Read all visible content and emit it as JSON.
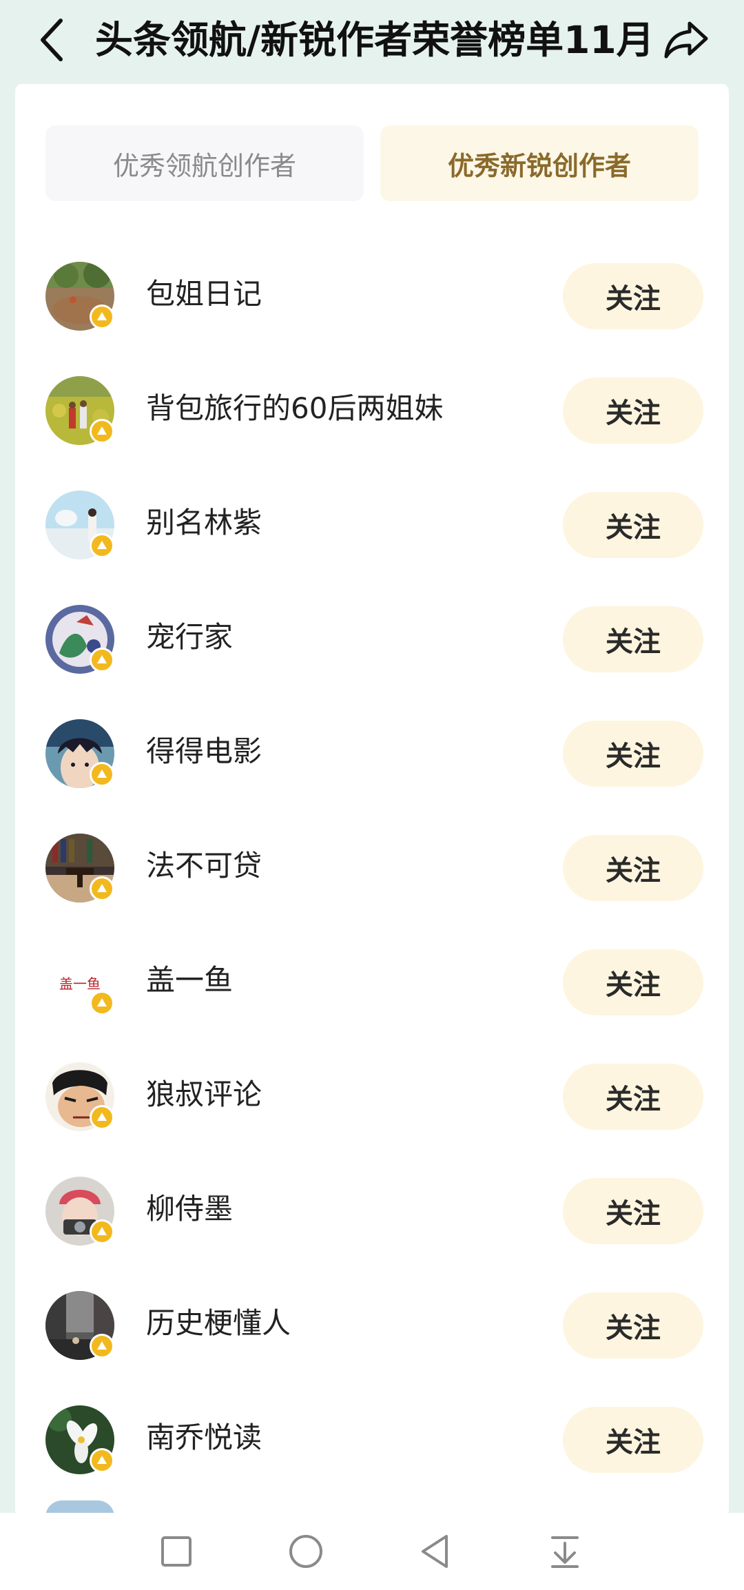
{
  "header": {
    "title": "头条领航/新锐作者荣誉榜单11月",
    "back_icon": "chevron-left-icon",
    "share_icon": "share-icon"
  },
  "tabs": [
    {
      "label": "优秀领航创作者",
      "selected": false
    },
    {
      "label": "优秀新锐创作者",
      "selected": true
    }
  ],
  "authors": [
    {
      "name": "包姐日记",
      "follow_label": "关注"
    },
    {
      "name": "背包旅行的60后两姐妹",
      "follow_label": "关注"
    },
    {
      "name": "别名林紫",
      "follow_label": "关注"
    },
    {
      "name": "宠行家",
      "follow_label": "关注"
    },
    {
      "name": "得得电影",
      "follow_label": "关注"
    },
    {
      "name": "法不可贷",
      "follow_label": "关注"
    },
    {
      "name": "盖一鱼",
      "follow_label": "关注",
      "avatar_text": "盖一鱼"
    },
    {
      "name": "狼叔评论",
      "follow_label": "关注"
    },
    {
      "name": "柳侍墨",
      "follow_label": "关注"
    },
    {
      "name": "历史梗懂人",
      "follow_label": "关注"
    },
    {
      "name": "南乔悦读",
      "follow_label": "关注"
    }
  ],
  "nav": {
    "items": [
      "square-icon",
      "circle-icon",
      "triangle-back-icon",
      "download-icon"
    ]
  },
  "colors": {
    "background": "#e6f2ee",
    "selected_tab_bg": "#fdf7e8",
    "selected_tab_text": "#8a6a2a",
    "follow_button_bg": "#fdf5df",
    "badge": "#f2b91f"
  }
}
